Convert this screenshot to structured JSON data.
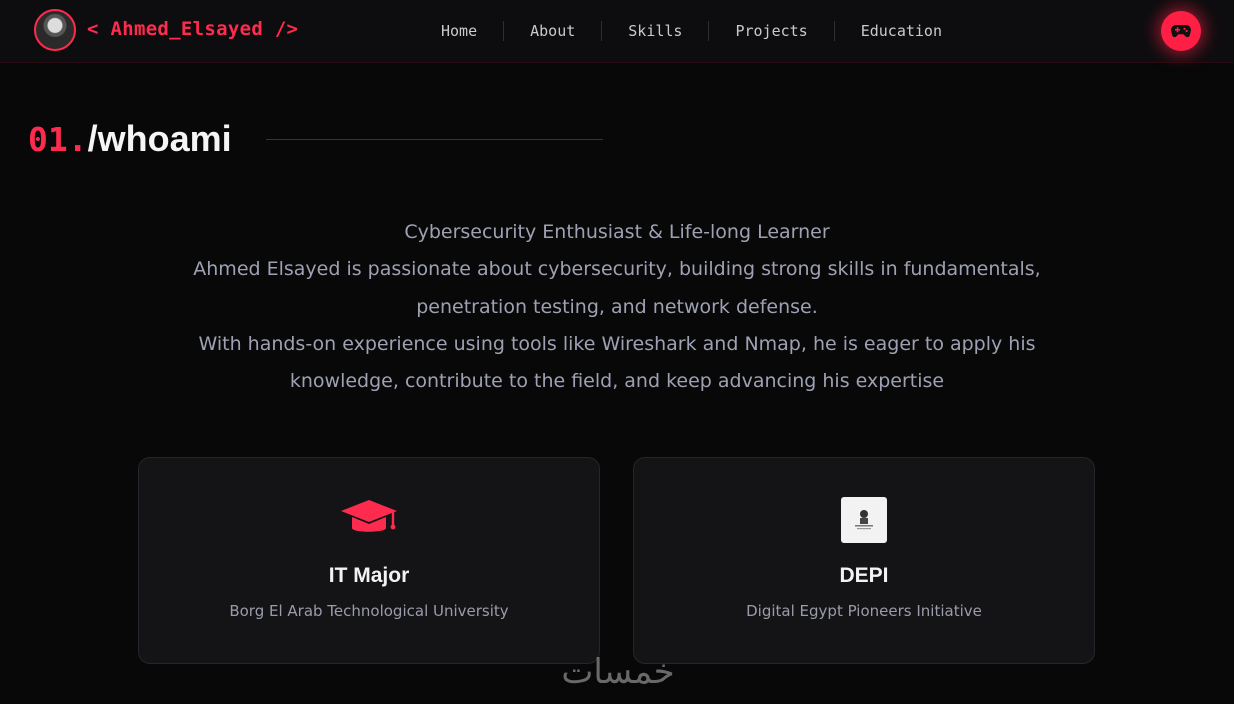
{
  "header": {
    "brand": "< Ahmed_Elsayed />",
    "nav": [
      {
        "label": "Home"
      },
      {
        "label": "About"
      },
      {
        "label": "Skills"
      },
      {
        "label": "Projects"
      },
      {
        "label": "Education"
      }
    ],
    "action_icon": "gamepad-icon",
    "accent_color": "#ff2b4f"
  },
  "section": {
    "number": "01.",
    "name": "/whoami"
  },
  "bio": {
    "lines": [
      "Cybersecurity Enthusiast & Life-long Learner",
      "Ahmed Elsayed is passionate about cybersecurity, building strong skills in fundamentals,",
      "penetration testing, and network defense.",
      "With hands-on experience using tools like Wireshark and Nmap, he is eager to apply his",
      "knowledge, contribute to the field, and keep advancing his expertise"
    ]
  },
  "cards": [
    {
      "icon": "graduation-cap-icon",
      "title": "IT Major",
      "subtitle": "Borg El Arab Technological University"
    },
    {
      "icon": "depi-logo",
      "title": "DEPI",
      "subtitle": "Digital Egypt Pioneers Initiative"
    }
  ],
  "watermark": "خمسات"
}
